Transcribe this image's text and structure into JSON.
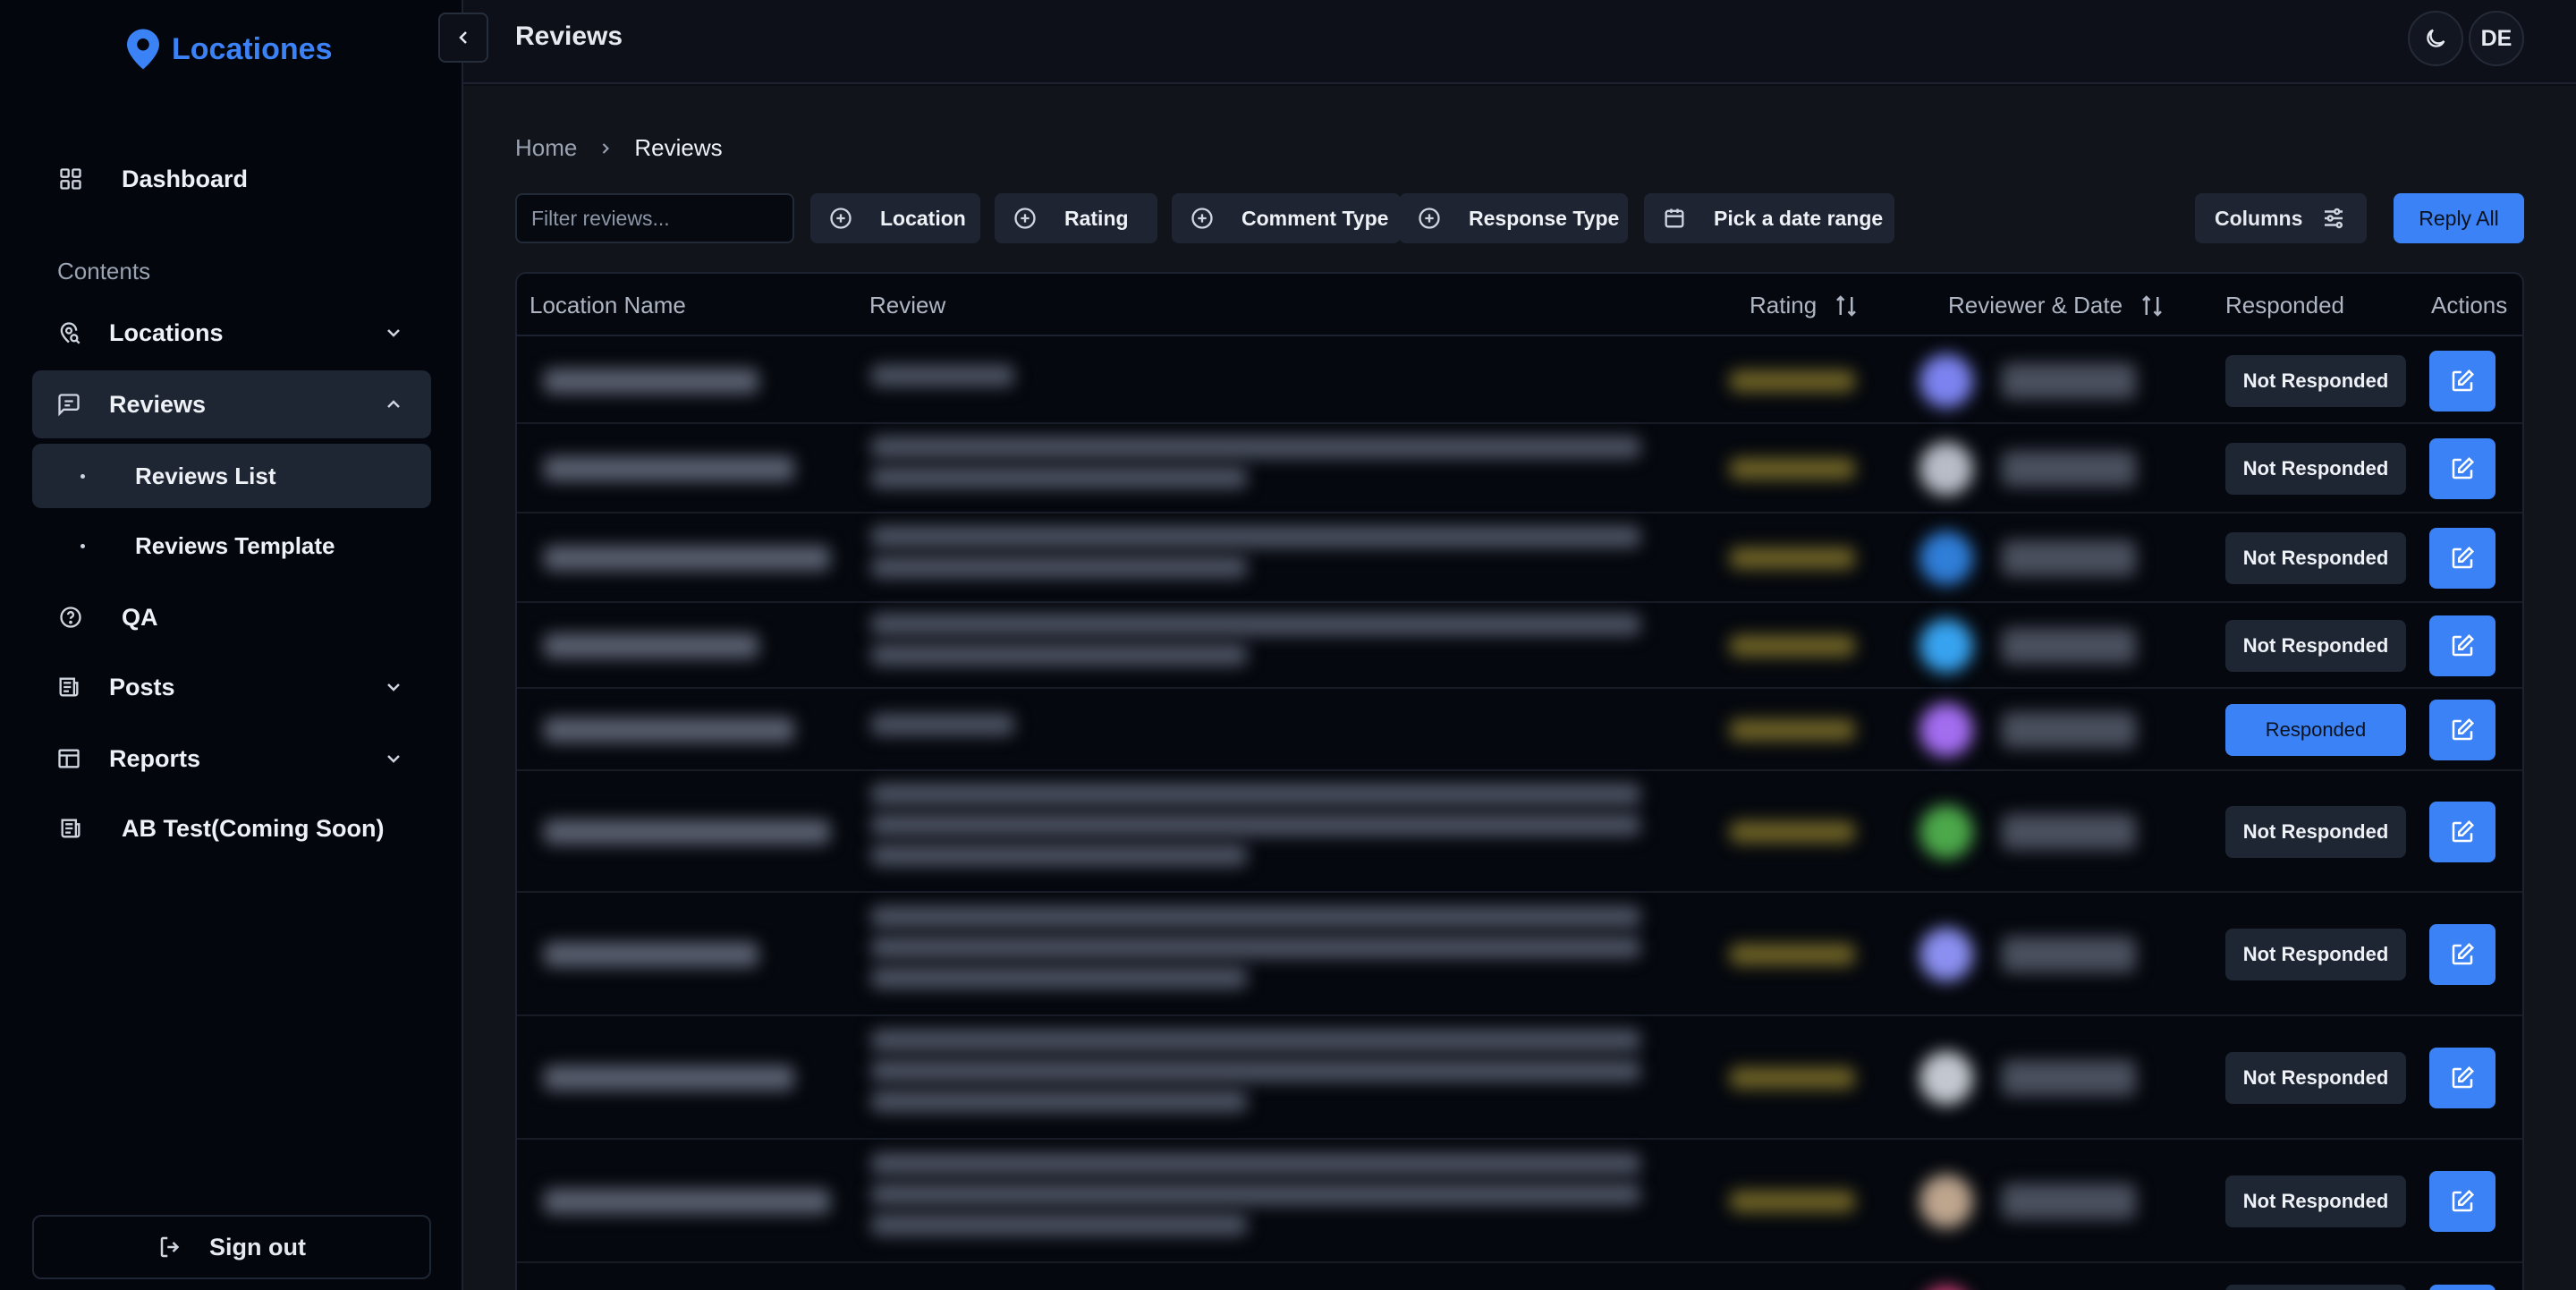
{
  "brand": {
    "name": "Locationes"
  },
  "sidebar": {
    "dashboard": "Dashboard",
    "section": "Contents",
    "locations": "Locations",
    "reviews": "Reviews",
    "reviews_list": "Reviews List",
    "reviews_template": "Reviews Template",
    "qa": "QA",
    "posts": "Posts",
    "reports": "Reports",
    "ab_test": "AB Test(Coming Soon)",
    "sign_out": "Sign out"
  },
  "header": {
    "title": "Reviews",
    "user_initials": "DE"
  },
  "breadcrumb": {
    "home": "Home",
    "current": "Reviews"
  },
  "toolbar": {
    "filter_placeholder": "Filter reviews...",
    "location": "Location",
    "rating": "Rating",
    "comment_type": "Comment Type",
    "response_type": "Response Type",
    "date_range": "Pick a date range",
    "columns": "Columns",
    "reply_all": "Reply All"
  },
  "table": {
    "headers": {
      "location_name": "Location Name",
      "review": "Review",
      "rating": "Rating",
      "reviewer_date": "Reviewer & Date",
      "responded": "Responded",
      "actions": "Actions"
    },
    "rows": [
      {
        "status": "Not Responded"
      },
      {
        "status": "Not Responded"
      },
      {
        "status": "Not Responded"
      },
      {
        "status": "Not Responded"
      },
      {
        "status": "Responded"
      },
      {
        "status": "Not Responded"
      },
      {
        "status": "Not Responded"
      },
      {
        "status": "Not Responded"
      },
      {
        "status": "Not Responded"
      }
    ]
  },
  "colors": {
    "accent": "#3b82f6",
    "background": "#11141b",
    "sidebar": "#03060d"
  }
}
